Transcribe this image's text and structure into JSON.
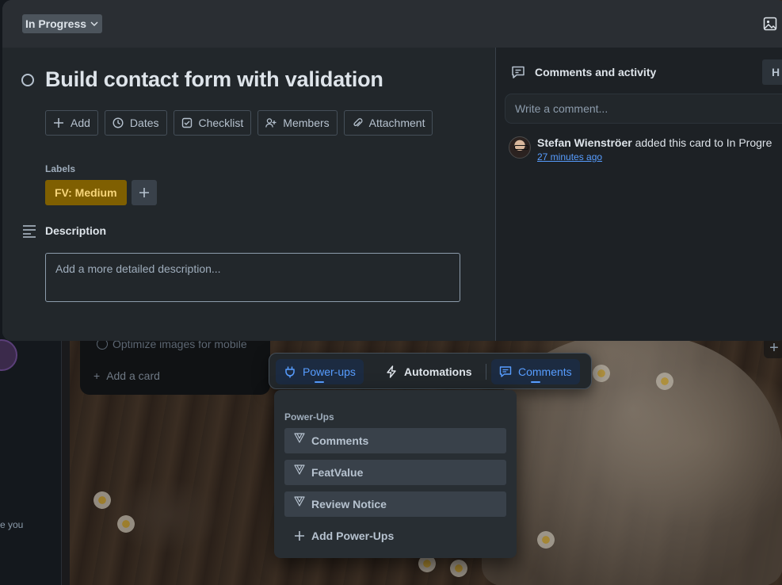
{
  "card": {
    "status": "In Progress",
    "title": "Build contact form with validation",
    "actions": [
      "Add",
      "Dates",
      "Checklist",
      "Members",
      "Attachment"
    ],
    "labels_heading": "Labels",
    "labels": [
      "FV: Medium"
    ],
    "description_heading": "Description",
    "description_placeholder": "Add a more detailed description..."
  },
  "activity": {
    "heading": "Comments and activity",
    "hide_button": "H",
    "comment_placeholder": "Write a comment...",
    "entries": [
      {
        "user": "Stefan Wienströer",
        "text": " added this card to In Progre",
        "time": "27 minutes ago"
      }
    ]
  },
  "board": {
    "card_peek": "Optimize images for mobile",
    "add_card": "Add a card",
    "sidebar_peek": "e you"
  },
  "bottom_bar": {
    "powerups": "Power-ups",
    "automations": "Automations",
    "comments": "Comments"
  },
  "powerups_menu": {
    "heading": "Power-Ups",
    "items": [
      "Comments",
      "FeatValue",
      "Review Notice"
    ],
    "add": "Add Power-Ups"
  },
  "colors": {
    "accent": "#579dff",
    "label_medium": "#7f5f01",
    "modal_bg": "#22272b"
  }
}
